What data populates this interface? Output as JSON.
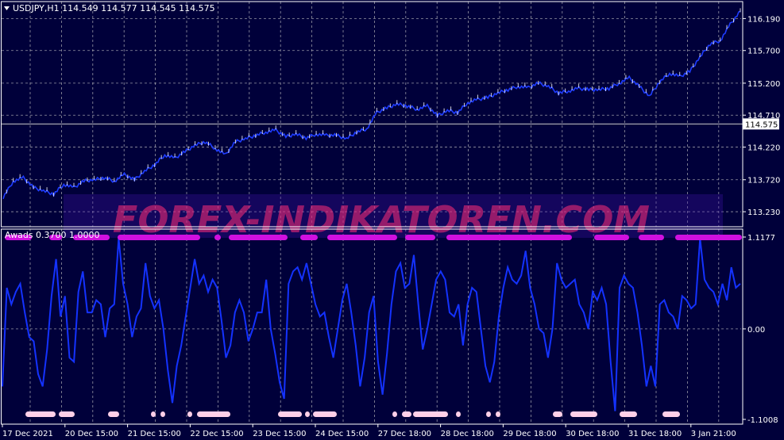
{
  "colors": {
    "background": "#00003a",
    "grid": "#c8c8c8",
    "price_line": "#1e3cff",
    "price_bar_up": "#ffffff",
    "indicator_line": "#1432ff",
    "awads_bar": "#d010e0",
    "awads_bottom_dots": "#ffd0e8",
    "watermark": "#ff2d78",
    "text": "#ffffff"
  },
  "price_panel": {
    "header": "USDJPY,H1  114.549 114.577 114.545 114.575",
    "price_tag": "114.575",
    "header_icon": "triangle-down-icon"
  },
  "indicator_panel": {
    "header": "Awads 0.3700 1.0000"
  },
  "watermark": "FOREX-INDIKATOREN.COM",
  "chart_data": [
    {
      "type": "line",
      "title": "USDJPY,H1",
      "ylim": [
        113.0,
        116.45
      ],
      "y_ticks": [
        "116.190",
        "115.700",
        "115.200",
        "114.710",
        "114.220",
        "113.720",
        "113.230"
      ],
      "current_price": 114.575,
      "x_tick_labels": [
        "17 Dec 2021",
        "20 Dec 15:00",
        "21 Dec 15:00",
        "22 Dec 15:00",
        "23 Dec 15:00",
        "24 Dec 15:00",
        "27 Dec 18:00",
        "28 Dec 18:00",
        "29 Dec 18:00",
        "30 Dec 18:00",
        "31 Dec 18:00",
        "3 Jan 21:00"
      ],
      "series": [
        {
          "values": [
            113.45,
            113.7,
            113.75,
            113.6,
            113.55,
            113.5,
            113.65,
            113.6,
            113.7,
            113.72,
            113.75,
            113.7,
            113.8,
            113.72,
            113.85,
            113.95,
            114.1,
            114.05,
            114.15,
            114.25,
            114.3,
            114.2,
            114.1,
            114.3,
            114.35,
            114.4,
            114.45,
            114.48,
            114.38,
            114.42,
            114.36,
            114.42,
            114.4,
            114.4,
            114.35,
            114.45,
            114.5,
            114.75,
            114.82,
            114.88,
            114.85,
            114.8,
            114.85,
            114.7,
            114.78,
            114.75,
            114.9,
            114.95,
            114.98,
            115.05,
            115.1,
            115.15,
            115.13,
            115.2,
            115.15,
            115.05,
            115.08,
            115.12,
            115.1,
            115.1,
            115.12,
            115.2,
            115.28,
            115.15,
            115.0,
            115.22,
            115.35,
            115.3,
            115.38,
            115.6,
            115.8,
            115.85,
            116.1,
            116.3
          ]
        }
      ]
    },
    {
      "type": "line",
      "title": "Awads 0.3700 1.0000",
      "ylim": [
        -1.1008,
        1.1177
      ],
      "y_ticks": [
        "1.1177",
        "0.00",
        "-1.1008"
      ],
      "series": [
        {
          "values": [
            -0.7,
            0.5,
            0.3,
            0.45,
            0.55,
            0.2,
            -0.1,
            -0.15,
            -0.55,
            -0.7,
            -0.25,
            0.4,
            0.85,
            0.15,
            0.4,
            -0.35,
            -0.4,
            0.45,
            0.7,
            0.2,
            0.2,
            0.35,
            0.3,
            -0.1,
            0.25,
            0.3,
            1.1,
            0.55,
            0.3,
            -0.1,
            0.15,
            0.25,
            0.8,
            0.4,
            0.25,
            0.35,
            0.0,
            -0.5,
            -0.9,
            -0.45,
            -0.2,
            0.15,
            0.5,
            0.85,
            0.55,
            0.65,
            0.45,
            0.6,
            0.5,
            0.1,
            -0.35,
            -0.2,
            0.2,
            0.35,
            0.2,
            -0.15,
            0.0,
            0.2,
            0.2,
            0.6,
            0.0,
            -0.3,
            -0.65,
            -0.85,
            0.55,
            0.7,
            0.75,
            0.6,
            0.8,
            0.55,
            0.3,
            0.15,
            0.2,
            -0.1,
            -0.35,
            0.0,
            0.35,
            0.55,
            0.2,
            -0.2,
            -0.7,
            -0.35,
            0.2,
            0.4,
            -0.4,
            -0.8,
            -0.3,
            0.3,
            0.7,
            0.8,
            0.5,
            0.55,
            0.9,
            0.3,
            -0.25,
            0.0,
            0.3,
            0.6,
            0.7,
            0.6,
            0.2,
            0.15,
            0.3,
            -0.2,
            0.3,
            0.5,
            0.45,
            0.0,
            -0.45,
            -0.65,
            -0.4,
            0.15,
            0.5,
            0.75,
            0.6,
            0.55,
            0.65,
            0.95,
            0.5,
            0.3,
            0.0,
            -0.05,
            -0.35,
            0.0,
            0.8,
            0.6,
            0.5,
            0.55,
            0.6,
            0.3,
            0.2,
            0.0,
            0.45,
            0.35,
            0.5,
            0.3,
            -0.4,
            -1.0,
            0.5,
            0.65,
            0.55,
            0.5,
            0.2,
            -0.2,
            -0.7,
            -0.45,
            -0.7,
            0.3,
            0.35,
            0.2,
            0.15,
            0.0,
            0.4,
            0.35,
            0.25,
            0.3,
            1.1,
            0.6,
            0.5,
            0.45,
            0.3,
            0.55,
            0.35,
            0.75,
            0.5,
            0.55
          ]
        }
      ]
    }
  ]
}
